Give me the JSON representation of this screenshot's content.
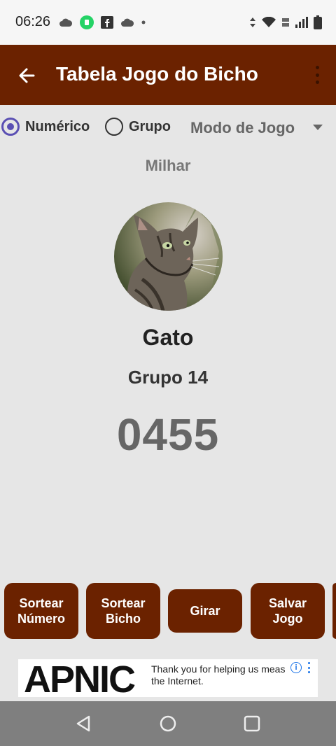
{
  "status_bar": {
    "time": "06:26",
    "icons": [
      "cloud-icon",
      "whatsapp-icon",
      "facebook-icon",
      "cloud-icon",
      "dot-icon",
      "data-arrows-icon",
      "wifi-icon",
      "volte-icon",
      "signal-icon",
      "battery-icon"
    ]
  },
  "app_bar": {
    "title": "Tabela Jogo do Bicho",
    "back_icon": "arrow-left-icon",
    "menu_icon": "more-vert-icon",
    "color": "#6b2200"
  },
  "controls": {
    "radio_numeric": "Numérico",
    "radio_group": "Grupo",
    "selected": "Numérico",
    "mode_dropdown": "Modo de Jogo"
  },
  "main": {
    "subtitle": "Milhar",
    "animal_name": "Gato",
    "group": "Grupo 14",
    "number": "0455"
  },
  "buttons": [
    {
      "label_line1": "Sortear",
      "label_line2": "Número"
    },
    {
      "label_line1": "Sortear",
      "label_line2": "Bicho"
    },
    {
      "label_line1": "Girar",
      "label_line2": ""
    },
    {
      "label_line1": "Salvar",
      "label_line2": "Jogo"
    }
  ],
  "ad": {
    "logo": "APNIC",
    "text_line1": "Thank you for helping us meas",
    "text_line2": "the Internet.",
    "info_icon": "info-icon",
    "menu_icon": "more-vert-icon"
  },
  "nav_bar": {
    "icons": [
      "back-triangle-icon",
      "home-circle-icon",
      "recents-square-icon"
    ]
  }
}
